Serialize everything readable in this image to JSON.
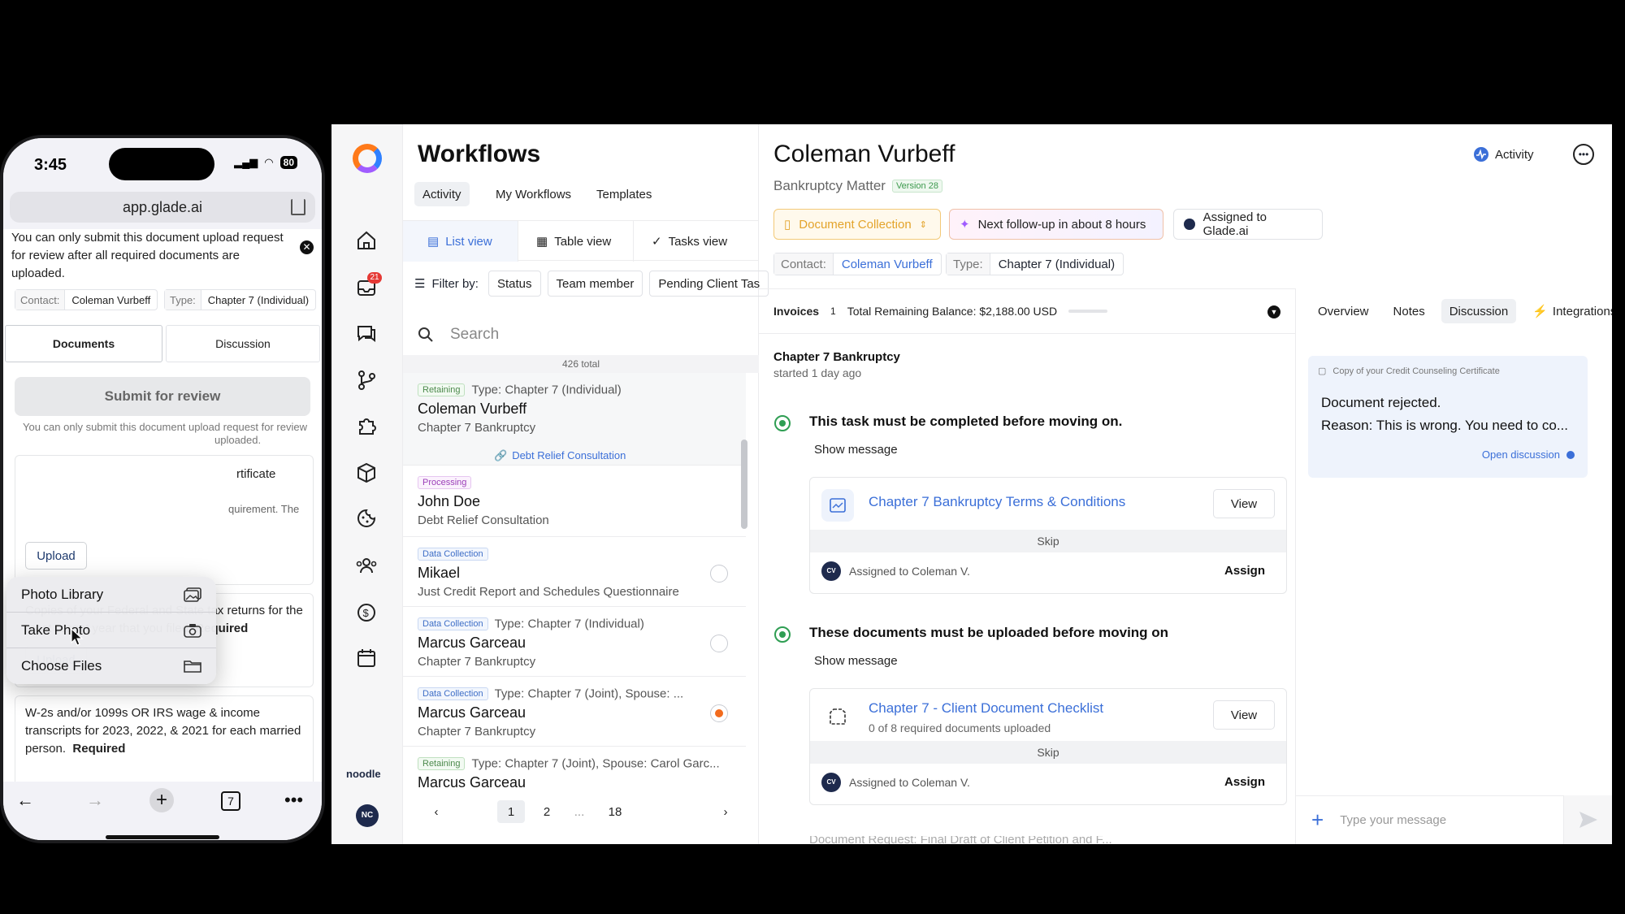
{
  "phone": {
    "time": "3:45",
    "battery": "80",
    "url": "app.glade.ai",
    "notice_top": "You can only submit this document upload request for review after all required documents are uploaded.",
    "contact_label": "Contact:",
    "contact_value": "Coleman Vurbeff",
    "type_label": "Type:",
    "type_value": "Chapter 7 (Individual)",
    "tabs": [
      "Documents",
      "Discussion"
    ],
    "submit_label": "Submit for review",
    "notice_bottom_line1": "You can only submit this document upload request for review",
    "notice_bottom_line2": "uploaded.",
    "card1_partial": "rtificate",
    "card1_partial2": "quirement. The",
    "upload_label": "Upload",
    "card2_text": "Copies of your Federal and State tax returns for the most recent year that you filed",
    "card3_text": "W-2s and/or 1099s OR IRS wage & income transcripts for 2023, 2022, & 2021 for each married person.",
    "required_label": "Required",
    "menu": [
      {
        "label": "Photo Library",
        "icon": "photo-library-icon"
      },
      {
        "label": "Take Photo",
        "icon": "camera-icon"
      },
      {
        "label": "Choose Files",
        "icon": "folder-icon"
      }
    ],
    "tabs_count": "7"
  },
  "rail": {
    "notification_count": "21",
    "brand": "noodle",
    "user_initials": "NC"
  },
  "workflows": {
    "title": "Workflows",
    "tabs": [
      "Activity",
      "My Workflows",
      "Templates"
    ],
    "views": [
      "List view",
      "Table view",
      "Tasks view"
    ],
    "filter_label": "Filter by:",
    "filters": [
      "Status",
      "Team member",
      "Pending Client Tas"
    ],
    "search_placeholder": "Search",
    "total": "426 total",
    "rows": [
      {
        "status": "Retaining",
        "type": "Type: Chapter 7 (Individual)",
        "name": "Coleman Vurbeff",
        "sub": "Chapter 7 Bankruptcy",
        "link": "Debt Relief Consultation"
      },
      {
        "status": "Processing",
        "type": "",
        "name": "John Doe",
        "sub": "Debt Relief Consultation"
      },
      {
        "status": "Data Collection",
        "type": "",
        "name": "Mikael",
        "sub": "Just Credit Report and Schedules Questionnaire"
      },
      {
        "status": "Data Collection",
        "type": "Type: Chapter 7 (Individual)",
        "name": "Marcus Garceau",
        "sub": "Chapter 7 Bankruptcy"
      },
      {
        "status": "Data Collection",
        "type": "Type: Chapter 7 (Joint), Spouse: ...",
        "name": "Marcus Garceau",
        "sub": "Chapter 7 Bankruptcy"
      },
      {
        "status": "Retaining",
        "type": "Type: Chapter 7 (Joint), Spouse: Carol Garc...",
        "name": "Marcus Garceau",
        "sub": ""
      }
    ],
    "pages": [
      "1",
      "2",
      "...",
      "18"
    ]
  },
  "detail": {
    "title": "Coleman Vurbeff",
    "subtitle": "Bankruptcy Matter",
    "version": "Version 28",
    "activity_label": "Activity",
    "stage": "Document Collection",
    "followup": "Next follow-up in about 8 hours",
    "assigned_to": "Assigned to Glade.ai",
    "contact_label": "Contact:",
    "contact_value": "Coleman Vurbeff",
    "type_label": "Type:",
    "type_value": "Chapter 7 (Individual)",
    "invoices_label": "Invoices",
    "invoices_count": "1",
    "balance": "Total Remaining Balance: $2,188.00 USD",
    "section_title": "Chapter 7 Bankruptcy",
    "section_sub": "started 1 day ago",
    "steps": [
      {
        "title": "This task must be completed before moving on.",
        "show": "Show message",
        "link": "Chapter 7 Bankruptcy Terms & Conditions",
        "meta": "",
        "view": "View",
        "skip": "Skip",
        "assigned": "Assigned to Coleman V.",
        "assign": "Assign",
        "avatar": "CV"
      },
      {
        "title": "These documents must be uploaded before moving on",
        "show": "Show message",
        "link": "Chapter 7 - Client Document Checklist",
        "meta": "0 of 8 required documents uploaded",
        "view": "View",
        "skip": "Skip",
        "assigned": "Assigned to Coleman V.",
        "assign": "Assign",
        "avatar": "CV"
      }
    ],
    "faded_text": "Document Request: Final Draft of Client Petition and F...",
    "right_tabs": [
      "Overview",
      "Notes",
      "Discussion",
      "Integrations"
    ],
    "discussion_note": "Copy of your Credit Counseling Certificate",
    "discussion_line1": "Document rejected.",
    "discussion_line2": "Reason: This is wrong. You need to co...",
    "open_discussion": "Open discussion",
    "message_placeholder": "Type your message"
  }
}
